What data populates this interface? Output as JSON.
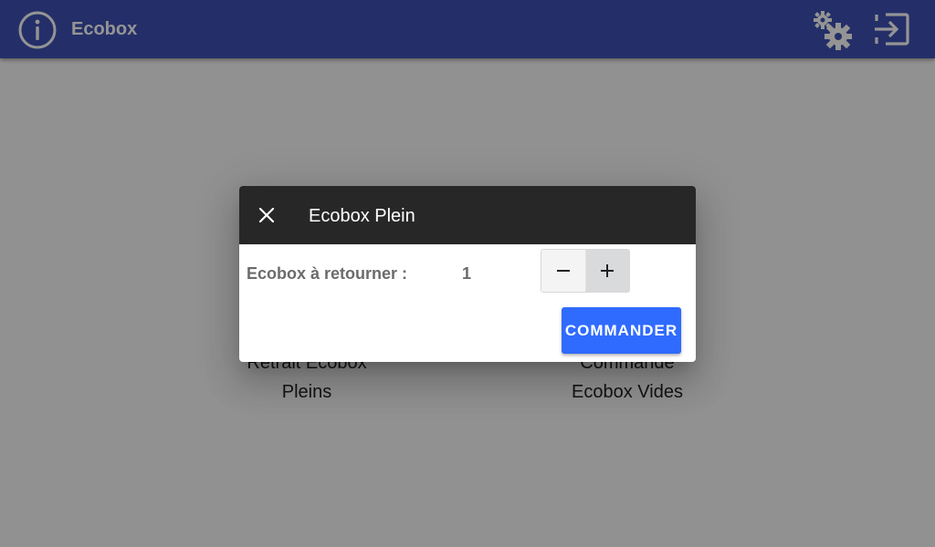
{
  "appbar": {
    "title": "Ecobox",
    "icons": {
      "left": "info-circle-icon",
      "settings": "gears-icon",
      "logout": "exit-icon"
    },
    "background_color": "#3f51b5",
    "icon_color": "#ffffff"
  },
  "tiles": [
    {
      "line1": "Retrait Ecobox",
      "line2": "Pleins"
    },
    {
      "line1": "Commande",
      "line2": "Ecobox Vides"
    }
  ],
  "dialog": {
    "title": "Ecobox Plein",
    "close_icon": "close-icon",
    "quantity_label": "Ecobox à retourner :",
    "quantity_value": "1",
    "decrement_icon": "minus-icon",
    "increment_icon": "plus-icon",
    "order_button_label": "COMMANDER",
    "toolbar_color": "#272727",
    "button_color": "#2f6bff"
  }
}
